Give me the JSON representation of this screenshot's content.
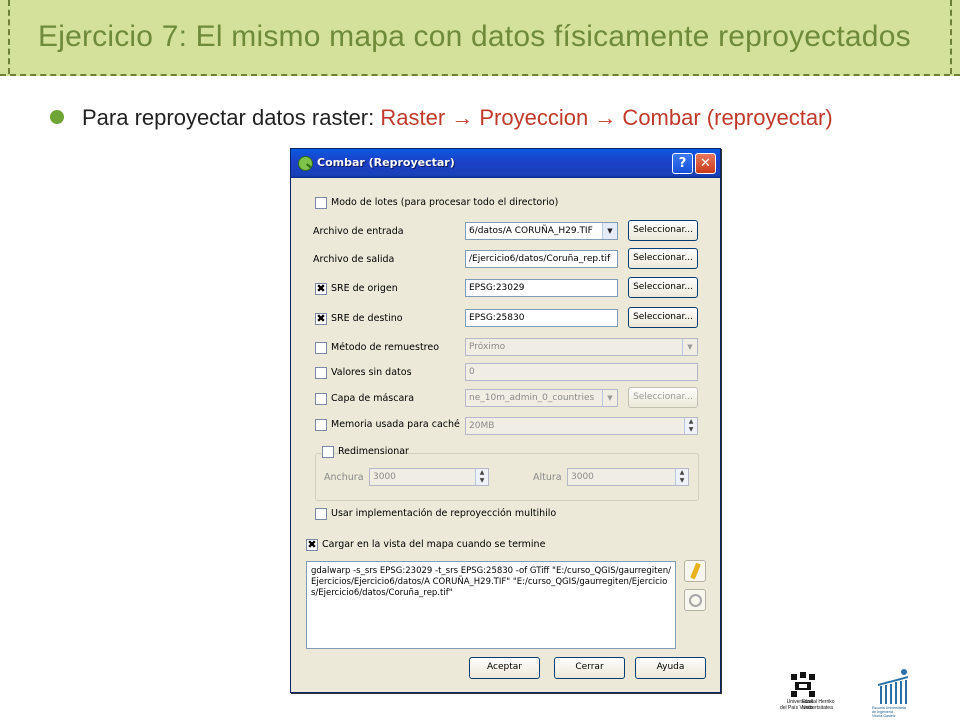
{
  "slide": {
    "title": "Ejercicio 7: El mismo mapa con datos físicamente reproyectados",
    "bullet_prefix": "Para reproyectar datos raster: ",
    "bullet_menu_path": "Raster → Proyeccion → Combar (reproyectar)"
  },
  "dialog": {
    "title": "Combar (Reproyectar)",
    "help_label": "?",
    "close_label": "✕",
    "batch_mode_label": "Modo de lotes (para procesar todo el directorio)",
    "input_file_label": "Archivo de entrada",
    "input_file_value": "6/datos/A CORUÑA_H29.TIF",
    "output_file_label": "Archivo de salida",
    "output_file_value": "/Ejercicio6/datos/Coruña_rep.tif",
    "source_srs_label": "SRE de origen",
    "source_srs_value": "EPSG:23029",
    "target_srs_label": "SRE de destino",
    "target_srs_value": "EPSG:25830",
    "select_label": "Seleccionar...",
    "resampling_label": "Método de remuestreo",
    "resampling_value": "Próximo",
    "nodata_label": "Valores sin datos",
    "nodata_value": "0",
    "mask_label": "Capa de máscara",
    "mask_value": "ne_10m_admin_0_countries",
    "cache_label": "Memoria usada para caché",
    "cache_value": "20MB",
    "resize_label": "Redimensionar",
    "width_label": "Anchura",
    "width_value": "3000",
    "height_label": "Altura",
    "height_value": "3000",
    "multithread_label": "Usar implementación de reproyección multihilo",
    "load_map_label": "Cargar en la vista del mapa cuando se termine",
    "command": "gdalwarp -s_srs EPSG:23029 -t_srs EPSG:25830 -of GTiff \"E:/curso_QGIS/gaurregiten/Ejercicios/Ejercicio6/datos/A CORUÑA_H29.TIF\" \"E:/curso_QGIS/gaurregiten/Ejercicios/Ejercicio6/datos/Coruña_rep.tif\"",
    "accept_label": "Aceptar",
    "close_button_label": "Cerrar",
    "help_button_label": "Ayuda",
    "checks": {
      "batch": "",
      "source_srs": "✖",
      "target_srs": "✖",
      "load_map": "✖"
    }
  },
  "logos": {
    "ehu_left": "Universidad\ndel País Vasco",
    "ehu_right": "Euskal Herriko\nUnibertsitatea",
    "escuela": "Escuela Universitaria\nde Ingeniería\nVitoria-Gasteiz"
  },
  "colors": {
    "title_band": "#d4e19a",
    "title_text": "#6f8a3a",
    "bullet": "#6ea536",
    "menu_path": "#c0392b",
    "dialog_titlebar": "#0a5ae0"
  }
}
